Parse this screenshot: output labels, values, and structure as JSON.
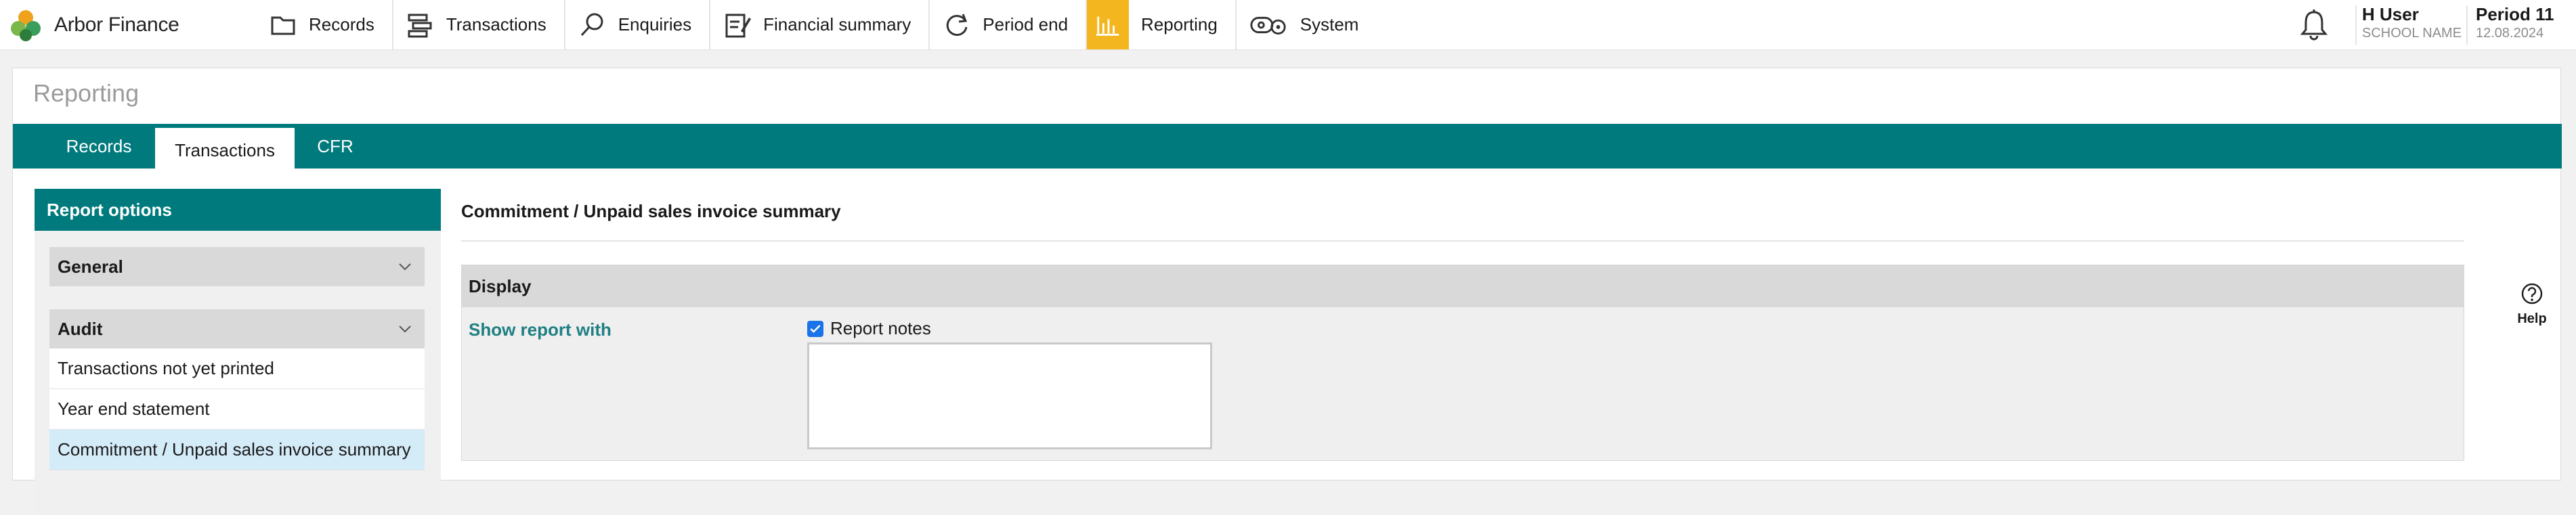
{
  "app": {
    "name": "Arbor Finance"
  },
  "nav": [
    {
      "label": "Records",
      "icon": "folder-icon"
    },
    {
      "label": "Transactions",
      "icon": "transactions-icon"
    },
    {
      "label": "Enquiries",
      "icon": "search-icon"
    },
    {
      "label": "Financial summary",
      "icon": "summary-icon"
    },
    {
      "label": "Period end",
      "icon": "refresh-icon"
    },
    {
      "label": "Reporting",
      "icon": "bar-chart-icon",
      "active": true
    },
    {
      "label": "System",
      "icon": "system-gears-icon"
    }
  ],
  "user": {
    "name": "H User",
    "school": "SCHOOL NAME"
  },
  "period": {
    "label": "Period 11",
    "date": "12.08.2024"
  },
  "page": {
    "title": "Reporting"
  },
  "tabs": [
    {
      "label": "Records"
    },
    {
      "label": "Transactions",
      "active": true
    },
    {
      "label": "CFR"
    }
  ],
  "options": {
    "header": "Report options",
    "groups": [
      {
        "label": "General"
      },
      {
        "label": "Audit",
        "items": [
          {
            "label": "Transactions not yet printed"
          },
          {
            "label": "Year end statement"
          },
          {
            "label": "Commitment / Unpaid sales invoice summary",
            "selected": true
          }
        ]
      }
    ]
  },
  "report": {
    "title": "Commitment / Unpaid sales invoice summary",
    "display_heading": "Display",
    "show_label": "Show report with",
    "checkbox_label": "Report notes",
    "checkbox_checked": true,
    "notes_value": ""
  },
  "help": {
    "label": "Help"
  },
  "colors": {
    "teal": "#007a7c",
    "accent": "#f3b61f",
    "selected": "#d4ebf8",
    "link": "#1f7f82"
  }
}
